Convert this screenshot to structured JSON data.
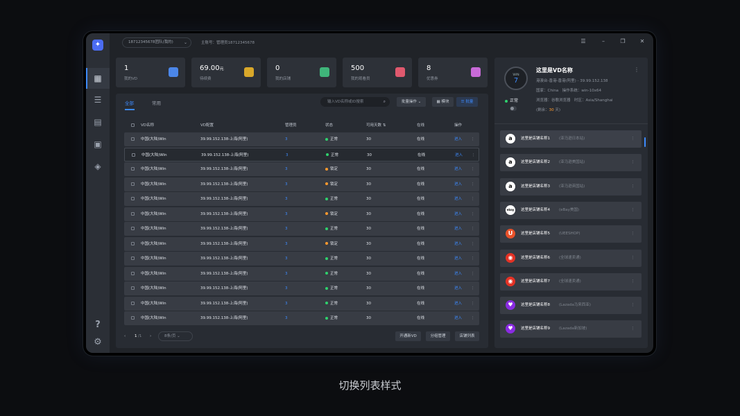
{
  "topbar": {
    "team": "18712345678团队(我的)",
    "main_account": "主账号：管理员18712345678"
  },
  "stats": [
    {
      "value": "1",
      "unit": "",
      "label": "我的VD"
    },
    {
      "value": "69.00",
      "unit": "元",
      "label": "待续费"
    },
    {
      "value": "0",
      "unit": "",
      "label": "我的店铺"
    },
    {
      "value": "500",
      "unit": "",
      "label": "我的观看员"
    },
    {
      "value": "8",
      "unit": "",
      "label": "优惠券"
    }
  ],
  "tabs": [
    "全部",
    "常用"
  ],
  "search": {
    "placeholder": "输入VD名称或ID搜索"
  },
  "actions": {
    "batch": "批量操作",
    "card": "模块",
    "list": "批量"
  },
  "table": {
    "headers": [
      "VD名称",
      "VD配置",
      "管理员",
      "状态",
      "可用天数",
      "在线",
      "操作"
    ],
    "rows": [
      {
        "name": "中国(大陆)Win",
        "config": "39.99.152.138-上海(阿里)",
        "admin": "3",
        "status": "正常",
        "days": "30",
        "online": "在线",
        "op": "进入"
      },
      {
        "name": "中国(大陆)Win",
        "config": "39.99.152.138-上海(阿里)",
        "admin": "3",
        "status": "正常",
        "days": "30",
        "online": "在线",
        "op": "进入"
      },
      {
        "name": "中国(大陆)Win",
        "config": "39.99.152.138-上海(阿里)",
        "admin": "3",
        "status": "锁定",
        "days": "30",
        "online": "在线",
        "op": "进入"
      },
      {
        "name": "中国(大陆)Win",
        "config": "39.99.152.138-上海(阿里)",
        "admin": "3",
        "status": "锁定",
        "days": "30",
        "online": "在线",
        "op": "进入"
      },
      {
        "name": "中国(大陆)Win",
        "config": "39.99.152.138-上海(阿里)",
        "admin": "3",
        "status": "正常",
        "days": "30",
        "online": "在线",
        "op": "进入"
      },
      {
        "name": "中国(大陆)Win",
        "config": "39.99.152.138-上海(阿里)",
        "admin": "3",
        "status": "锁定",
        "days": "30",
        "online": "在线",
        "op": "进入"
      },
      {
        "name": "中国(大陆)Win",
        "config": "39.99.152.138-上海(阿里)",
        "admin": "3",
        "status": "正常",
        "days": "30",
        "online": "在线",
        "op": "进入"
      },
      {
        "name": "中国(大陆)Win",
        "config": "39.99.152.138-上海(阿里)",
        "admin": "3",
        "status": "锁定",
        "days": "30",
        "online": "在线",
        "op": "进入"
      },
      {
        "name": "中国(大陆)Win",
        "config": "39.99.152.138-上海(阿里)",
        "admin": "3",
        "status": "正常",
        "days": "30",
        "online": "在线",
        "op": "进入"
      },
      {
        "name": "中国(大陆)Win",
        "config": "39.99.152.138-上海(阿里)",
        "admin": "3",
        "status": "正常",
        "days": "30",
        "online": "在线",
        "op": "进入"
      },
      {
        "name": "中国(大陆)Win",
        "config": "39.99.152.138-上海(阿里)",
        "admin": "3",
        "status": "正常",
        "days": "30",
        "online": "在线",
        "op": "进入"
      },
      {
        "name": "中国(大陆)Win",
        "config": "39.99.152.138-上海(阿里)",
        "admin": "3",
        "status": "正常",
        "days": "30",
        "online": "在线",
        "op": "进入"
      },
      {
        "name": "中国(大陆)Win",
        "config": "39.99.152.138-上海(阿里)",
        "admin": "3",
        "status": "正常",
        "days": "30",
        "online": "在线",
        "op": "进入"
      }
    ]
  },
  "pagination": {
    "current": "1",
    "total": "/1",
    "per_page": "8条/页"
  },
  "footer_buttons": [
    "开通新VD",
    "分组管理",
    "店铺列表"
  ],
  "detail": {
    "avatar_os": "WIN",
    "avatar_num": "7",
    "title": "这里是VD名称",
    "line1": "港澳台-香港-香港(阿里) - 39.99.152.138",
    "line2": "国家：China　操作系统：win-10x64",
    "line3": "浏览器：谷歌浏览器　时区：Asia/Shanghai",
    "line4_prefix": "(剩余：",
    "line4_days": "30",
    "line4_suffix": " 天)",
    "status": "正常"
  },
  "stores": [
    {
      "name": "这里是店铺名称1",
      "platform": "(亚马逊日本站)",
      "icon": "amazon-icon",
      "icon_text": "a",
      "color": "#ffffff"
    },
    {
      "name": "这里是店铺名称2",
      "platform": "(亚马逊美国站)",
      "icon": "amazon-icon",
      "icon_text": "a",
      "color": "#ffffff"
    },
    {
      "name": "这里是店铺名称3",
      "platform": "(亚马逊英国站)",
      "icon": "amazon-icon",
      "icon_text": "a",
      "color": "#ffffff"
    },
    {
      "name": "这里是店铺名称4",
      "platform": "(eBay美国)",
      "icon": "ebay-icon",
      "icon_text": "ebay",
      "color": "#ffffff"
    },
    {
      "name": "这里是店铺名称5",
      "platform": "(UEESHOP)",
      "icon": "ueeshop-icon",
      "icon_text": "U",
      "color": "#e8512a"
    },
    {
      "name": "这里是店铺名称6",
      "platform": "(全球速卖通)",
      "icon": "aliexpress-icon",
      "icon_text": "◉",
      "color": "#e43225"
    },
    {
      "name": "这里是店铺名称7",
      "platform": "(全球速卖通)",
      "icon": "aliexpress-icon",
      "icon_text": "◉",
      "color": "#e43225"
    },
    {
      "name": "这里是店铺名称8",
      "platform": "(Lazada马来西亚)",
      "icon": "lazada-icon",
      "icon_text": "♥",
      "color": "#8a2be2"
    },
    {
      "name": "这里是店铺名称9",
      "platform": "(Lazada新加坡)",
      "icon": "lazada-icon",
      "icon_text": "♥",
      "color": "#8a2be2"
    }
  ],
  "caption": "切换列表样式",
  "colors": {
    "accent": "#3d8bff",
    "status_ok": "#2fd16d",
    "status_locked": "#ff9a2e"
  }
}
